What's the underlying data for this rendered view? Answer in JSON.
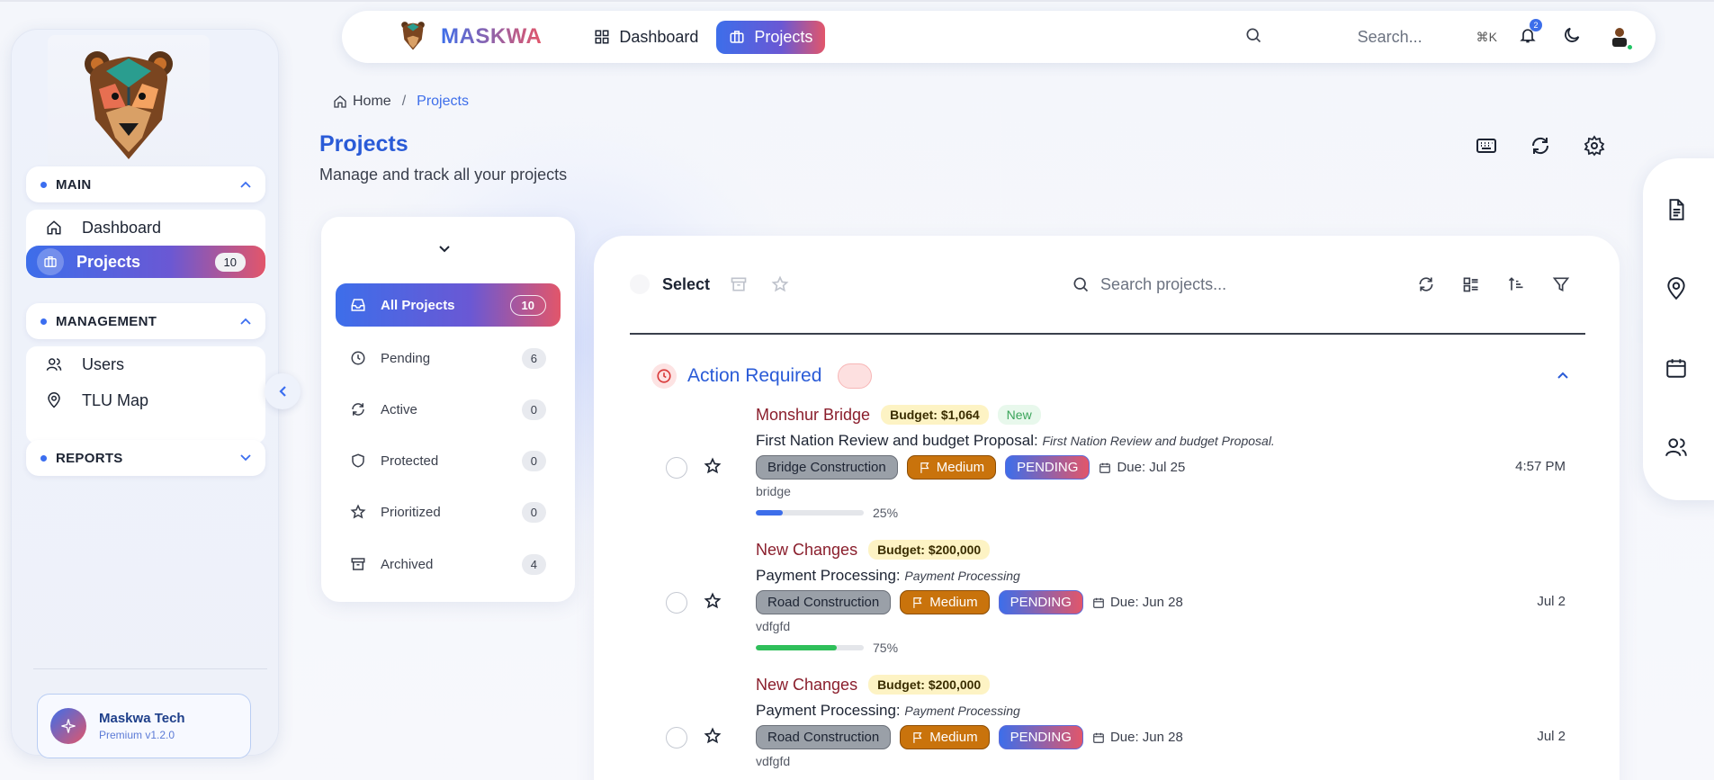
{
  "app": {
    "brand": "MASKWA"
  },
  "topnav": {
    "items": [
      {
        "label": "Dashboard",
        "icon": "grid-icon",
        "active": false
      },
      {
        "label": "Projects",
        "icon": "briefcase-icon",
        "active": true
      }
    ],
    "search_placeholder": "Search...",
    "shortcut": "⌘K",
    "notifications": "2"
  },
  "sidebar": {
    "sections": [
      {
        "title": "MAIN",
        "expanded": true,
        "items": [
          {
            "label": "Dashboard",
            "icon": "home-icon"
          },
          {
            "label": "Projects",
            "icon": "briefcase-icon",
            "count": "10",
            "active": true
          }
        ]
      },
      {
        "title": "MANAGEMENT",
        "expanded": true,
        "items": [
          {
            "label": "Users",
            "icon": "users-icon"
          },
          {
            "label": "TLU Map",
            "icon": "map-pin-icon"
          }
        ]
      },
      {
        "title": "REPORTS",
        "expanded": false,
        "items": []
      }
    ],
    "brand_card": {
      "name": "Maskwa Tech",
      "version": "Premium v1.2.0"
    }
  },
  "breadcrumb": {
    "home": "Home",
    "sep": "/",
    "current": "Projects"
  },
  "page": {
    "title": "Projects",
    "subtitle": "Manage and track all your projects"
  },
  "filters": [
    {
      "label": "All Projects",
      "count": "10",
      "icon": "inbox-icon",
      "active": true
    },
    {
      "label": "Pending",
      "count": "6",
      "icon": "clock-icon"
    },
    {
      "label": "Active",
      "count": "0",
      "icon": "refresh-icon"
    },
    {
      "label": "Protected",
      "count": "0",
      "icon": "shield-icon"
    },
    {
      "label": "Prioritized",
      "count": "0",
      "icon": "star-icon"
    },
    {
      "label": "Archived",
      "count": "4",
      "icon": "archive-icon"
    }
  ],
  "toolbar": {
    "select_label": "Select",
    "search_placeholder": "Search projects..."
  },
  "group": {
    "title": "Action Required"
  },
  "projects": [
    {
      "name": "Monshur Bridge",
      "budget": "Budget: $1,064",
      "new": "New",
      "title": "First Nation Review and budget Proposal:",
      "desc": "First Nation Review and budget Proposal.",
      "category": "Bridge Construction",
      "priority": "Medium",
      "status": "PENDING",
      "due": "Due: Jul 25",
      "note": "bridge",
      "progress": 25,
      "progress_label": "25%",
      "progress_color": "#3d6eea",
      "time": "4:57 PM"
    },
    {
      "name": "New Changes",
      "budget": "Budget: $200,000",
      "new": "",
      "title": "Payment Processing:",
      "desc": "Payment Processing",
      "category": "Road Construction",
      "priority": "Medium",
      "status": "PENDING",
      "due": "Due: Jun 28",
      "note": "vdfgfd",
      "progress": 75,
      "progress_label": "75%",
      "progress_color": "#2fbf5a",
      "time": "Jul 2"
    },
    {
      "name": "New Changes",
      "budget": "Budget: $200,000",
      "new": "",
      "title": "Payment Processing:",
      "desc": "Payment Processing",
      "category": "Road Construction",
      "priority": "Medium",
      "status": "PENDING",
      "due": "Due: Jun 28",
      "note": "vdfgfd",
      "progress": null,
      "progress_label": "",
      "progress_color": "",
      "time": "Jul 2"
    }
  ],
  "colors": {
    "accent": "#3d6eea",
    "accent2": "#e2566a",
    "title": "#2a5bd7"
  }
}
